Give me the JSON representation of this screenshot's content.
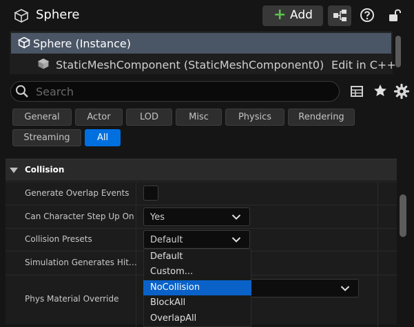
{
  "header": {
    "title": "Sphere",
    "add_label": "Add"
  },
  "tree": {
    "instance_label": "Sphere (Instance)",
    "component_label": "StaticMeshComponent (StaticMeshComponent0)",
    "edit_link": "Edit in C++"
  },
  "search": {
    "placeholder": "Search"
  },
  "filters": [
    "General",
    "Actor",
    "LOD",
    "Misc",
    "Physics",
    "Rendering",
    "Streaming",
    "All"
  ],
  "active_filter": "All",
  "section": {
    "title": "Collision",
    "properties": [
      {
        "label": "Generate Overlap Events",
        "value": ""
      },
      {
        "label": "Can Character Step Up On",
        "value": "Yes"
      },
      {
        "label": "Collision Presets",
        "value": "Default"
      },
      {
        "label": "Simulation Generates Hit…",
        "value": ""
      },
      {
        "label": "Phys Material Override",
        "value": ""
      }
    ]
  },
  "dropdown": {
    "options": [
      "Default",
      "Custom...",
      "NoCollision",
      "BlockAll",
      "OverlapAll"
    ],
    "highlighted": "NoCollision"
  },
  "colors": {
    "accent": "#0070e0",
    "selection": "#0a62c8",
    "add_plus": "#5ac44a",
    "tree_selected": "#4a5566"
  }
}
